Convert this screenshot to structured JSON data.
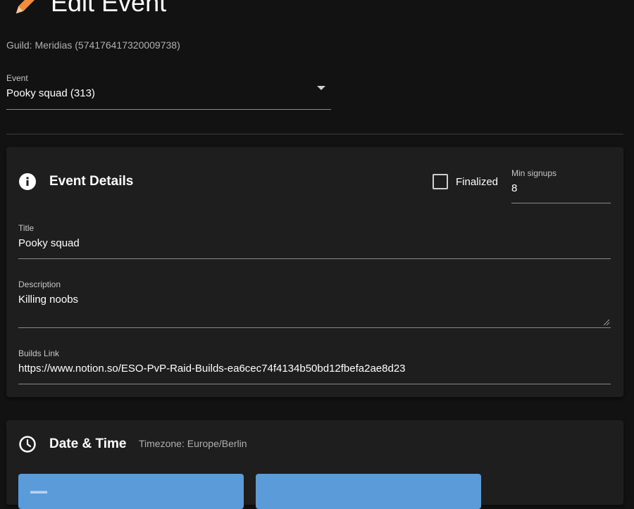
{
  "header": {
    "title": "Edit Event",
    "icon": "pencil-icon"
  },
  "guild": {
    "text": "Guild: Meridias (574176417320009738)"
  },
  "event_select": {
    "label": "Event",
    "value": "Pooky squad (313)"
  },
  "event_details": {
    "title": "Event Details",
    "icon": "info-icon",
    "finalized_label": "Finalized",
    "finalized_checked": false,
    "min_signups": {
      "label": "Min signups",
      "value": "8"
    },
    "title_field": {
      "label": "Title",
      "value": "Pooky squad"
    },
    "description_field": {
      "label": "Description",
      "value": "Killing noobs"
    },
    "builds_field": {
      "label": "Builds Link",
      "value": "https://www.notion.so/ESO-PvP-Raid-Builds-ea6cec74f4134b50bd12fbefa2ae8d23"
    }
  },
  "date_time": {
    "title": "Date & Time",
    "icon": "clock-icon",
    "timezone": "Timezone: Europe/Berlin"
  },
  "colors": {
    "background": "#121212",
    "card": "#1e1e1e",
    "accent_button": "#5b9bd9",
    "pencil_orange": "#f08c3c"
  }
}
